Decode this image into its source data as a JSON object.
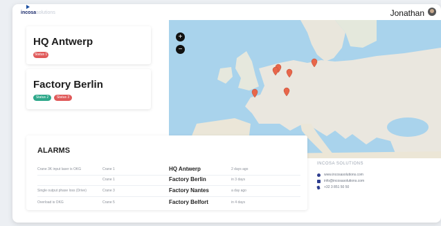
{
  "app": {
    "logo_brand": "incosa",
    "logo_suffix": "solutions",
    "user_name": "Jonathan"
  },
  "sites": [
    {
      "name": "HQ Antwerp",
      "badges": [
        {
          "label": "Status 1",
          "color": "#e05a5a"
        }
      ]
    },
    {
      "name": "Factory Berlin",
      "badges": [
        {
          "label": "Status 2",
          "color": "#2ea88a"
        },
        {
          "label": "Status 3",
          "color": "#e05a5a"
        }
      ]
    }
  ],
  "map": {
    "zoom_in": "+",
    "zoom_out": "−",
    "marker_color": "#e8664a"
  },
  "alarms": {
    "title": "ALARMS",
    "rows": [
      {
        "text": "Crane 3K input laser is OKG",
        "crane": "Crane 1",
        "site": "HQ Antwerp",
        "time": "2 days ago"
      },
      {
        "text": "",
        "crane": "Crane 1",
        "site": "Factory Berlin",
        "time": "in 3 days"
      },
      {
        "text": "Single output phase loss (Drive)",
        "crane": "Crane 3",
        "site": "Factory Nantes",
        "time": "a day ago"
      },
      {
        "text": "Overload is OKG",
        "crane": "Crane 5",
        "site": "Factory Belfort",
        "time": "in 4 days"
      }
    ]
  },
  "contact": {
    "title": "INCOSA SOLUTIONS",
    "items": [
      {
        "icon": "globe-icon",
        "text": "www.incosasolutions.com"
      },
      {
        "icon": "mail-icon",
        "text": "info@incosasolutions.com"
      },
      {
        "icon": "phone-icon",
        "text": "+32 3 851 50 50"
      }
    ]
  }
}
